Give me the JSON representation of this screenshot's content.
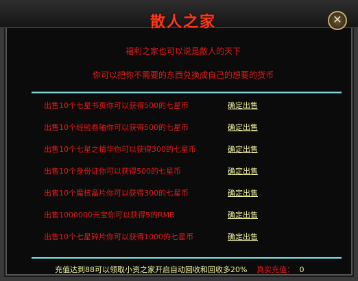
{
  "window": {
    "title": "散人之家",
    "close_glyph": "✕"
  },
  "intro": {
    "line1": "福利之家也可以说是散人的天下",
    "line2": "你可以把你不需要的东西兑换成自己的想要的货币"
  },
  "items": [
    {
      "text": "出售10个七星书页你可以获得500的七星币",
      "action": "确定出售"
    },
    {
      "text": "出售10个经验卷轴你可以获得500的七星币",
      "action": "确定出售"
    },
    {
      "text": "出售10个七星之精华你可以获得300的七星币",
      "action": "确定出售"
    },
    {
      "text": "出售10个身份证你可以获得500的七星币",
      "action": "确定出售"
    },
    {
      "text": "出售10个魔核晶片你可以获得300的七星币",
      "action": "确定出售"
    },
    {
      "text": "出售1000000元宝你可以获得5的RMB",
      "action": "确定出售"
    },
    {
      "text": "出售10个七星碎片你可以获得1000的七星币",
      "action": "确定出售"
    }
  ],
  "footer": {
    "notice": "充值达到88可以领取小资之家开启自动回收和回收多20%",
    "recharge_label": "真实充值：",
    "recharge_value": "0"
  },
  "colors": {
    "title": "#ff3a1a",
    "text": "#e81a1a",
    "link": "#f2f2a0",
    "rule": "#7fd4d4"
  }
}
